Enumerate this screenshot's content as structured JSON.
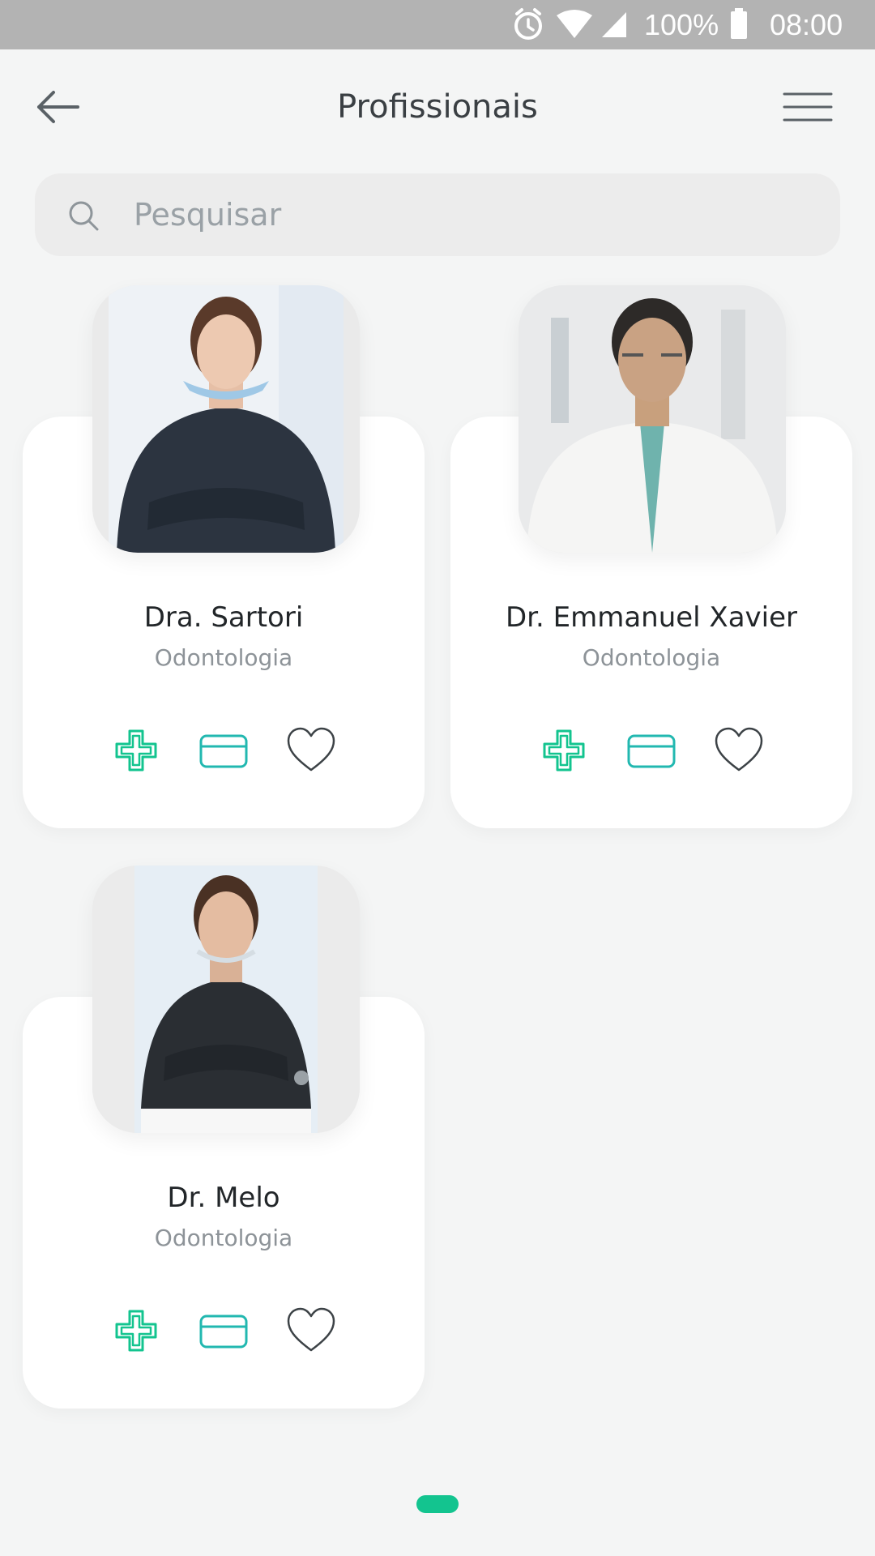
{
  "status_bar": {
    "battery": "100%",
    "time": "08:00"
  },
  "header": {
    "title": "Profissionais"
  },
  "search": {
    "placeholder": "Pesquisar"
  },
  "professionals": [
    {
      "name": "Dra. Sartori",
      "specialty": "Odontologia"
    },
    {
      "name": "Dr. Emmanuel Xavier",
      "specialty": "Odontologia"
    },
    {
      "name": "Dr. Melo",
      "specialty": "Odontologia"
    }
  ],
  "card_actions": [
    "medical-cross-icon",
    "credit-card-icon",
    "heart-icon"
  ],
  "colors": {
    "accent": "#13c48f",
    "icon_teal": "#22b8b0",
    "background": "#f4f5f5",
    "status_bar": "#b3b3b3"
  },
  "pager": {
    "pages": 1,
    "current": 1
  }
}
